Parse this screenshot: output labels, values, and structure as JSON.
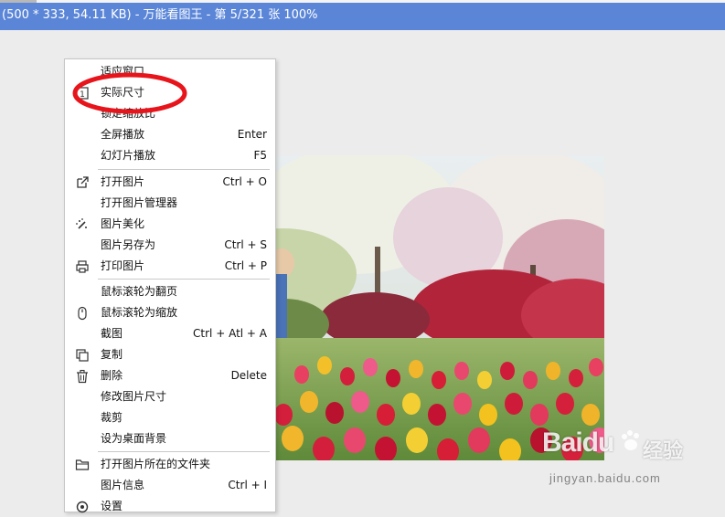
{
  "window": {
    "title": "(500 * 333, 54.11 KB) - 万能看图王 - 第 5/321 张 100%"
  },
  "colors": {
    "titlebar": "#5b86d8",
    "annotation_ring": "#e8141b",
    "menu_background": "#ffffff"
  },
  "context_menu": {
    "items": [
      {
        "label": "适应窗口",
        "shortcut": "",
        "icon": ""
      },
      {
        "label": "实际尺寸",
        "shortcut": "",
        "icon": "actual-size-icon"
      },
      {
        "label": "锁定缩放比",
        "shortcut": "",
        "icon": ""
      },
      {
        "label": "全屏播放",
        "shortcut": "Enter",
        "icon": ""
      },
      {
        "label": "幻灯片播放",
        "shortcut": "F5",
        "icon": ""
      },
      {
        "label": "打开图片",
        "shortcut": "Ctrl + O",
        "icon": "open-external-icon"
      },
      {
        "label": "打开图片管理器",
        "shortcut": "",
        "icon": ""
      },
      {
        "label": "图片美化",
        "shortcut": "",
        "icon": "magic-wand-icon"
      },
      {
        "label": "图片另存为",
        "shortcut": "Ctrl + S",
        "icon": ""
      },
      {
        "label": "打印图片",
        "shortcut": "Ctrl + P",
        "icon": "printer-icon"
      },
      {
        "label": "鼠标滚轮为翻页",
        "shortcut": "",
        "icon": ""
      },
      {
        "label": "鼠标滚轮为缩放",
        "shortcut": "",
        "icon": "mouse-icon"
      },
      {
        "label": "截图",
        "shortcut": "Ctrl + Atl + A",
        "icon": ""
      },
      {
        "label": "复制",
        "shortcut": "",
        "icon": "copy-icon"
      },
      {
        "label": "删除",
        "shortcut": "Delete",
        "icon": "trash-icon"
      },
      {
        "label": "修改图片尺寸",
        "shortcut": "",
        "icon": ""
      },
      {
        "label": "裁剪",
        "shortcut": "",
        "icon": ""
      },
      {
        "label": "设为桌面背景",
        "shortcut": "",
        "icon": ""
      },
      {
        "label": "打开图片所在的文件夹",
        "shortcut": "",
        "icon": "folder-icon"
      },
      {
        "label": "图片信息",
        "shortcut": "Ctrl + I",
        "icon": ""
      },
      {
        "label": "设置",
        "shortcut": "",
        "icon": "gear-icon"
      }
    ]
  },
  "watermark": {
    "logo": "Baidu",
    "product": "经验",
    "url": "jingyan.baidu.com"
  }
}
